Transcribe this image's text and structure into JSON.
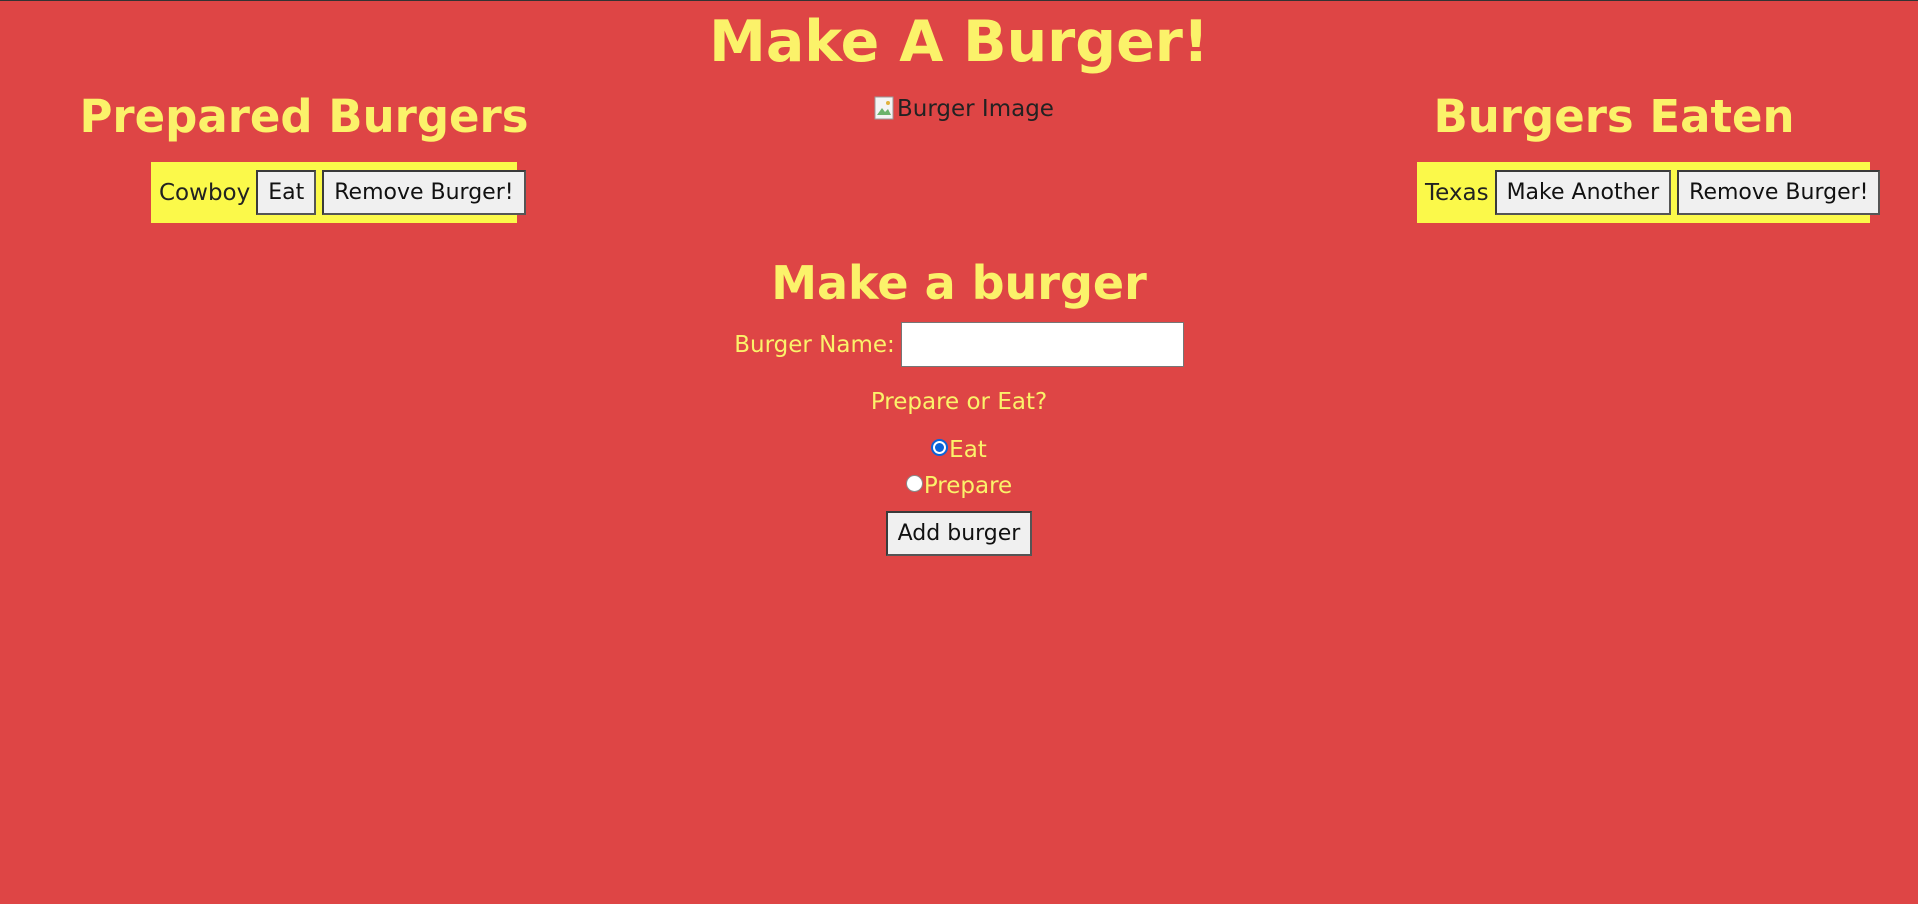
{
  "page": {
    "title": "Make A Burger!",
    "background_color": "#de4545",
    "accent_color": "#fbf26a",
    "card_color": "#fbf94a"
  },
  "prepared": {
    "heading": "Prepared Burgers",
    "items": [
      {
        "name": "Cowboy",
        "primary_action": "Eat",
        "remove_action": "Remove Burger!"
      }
    ]
  },
  "burger_image": {
    "alt": "Burger Image",
    "icon": "broken-image-icon"
  },
  "eaten": {
    "heading": "Burgers Eaten",
    "items": [
      {
        "name": "Texas",
        "primary_action": "Make Another",
        "remove_action": "Remove Burger!"
      }
    ]
  },
  "form": {
    "heading": "Make a burger",
    "name_label": "Burger Name:",
    "name_value": "",
    "name_placeholder": "",
    "choice_prompt": "Prepare or Eat?",
    "options": [
      {
        "label": "Eat",
        "checked": true
      },
      {
        "label": "Prepare",
        "checked": false
      }
    ],
    "submit_label": "Add burger"
  }
}
